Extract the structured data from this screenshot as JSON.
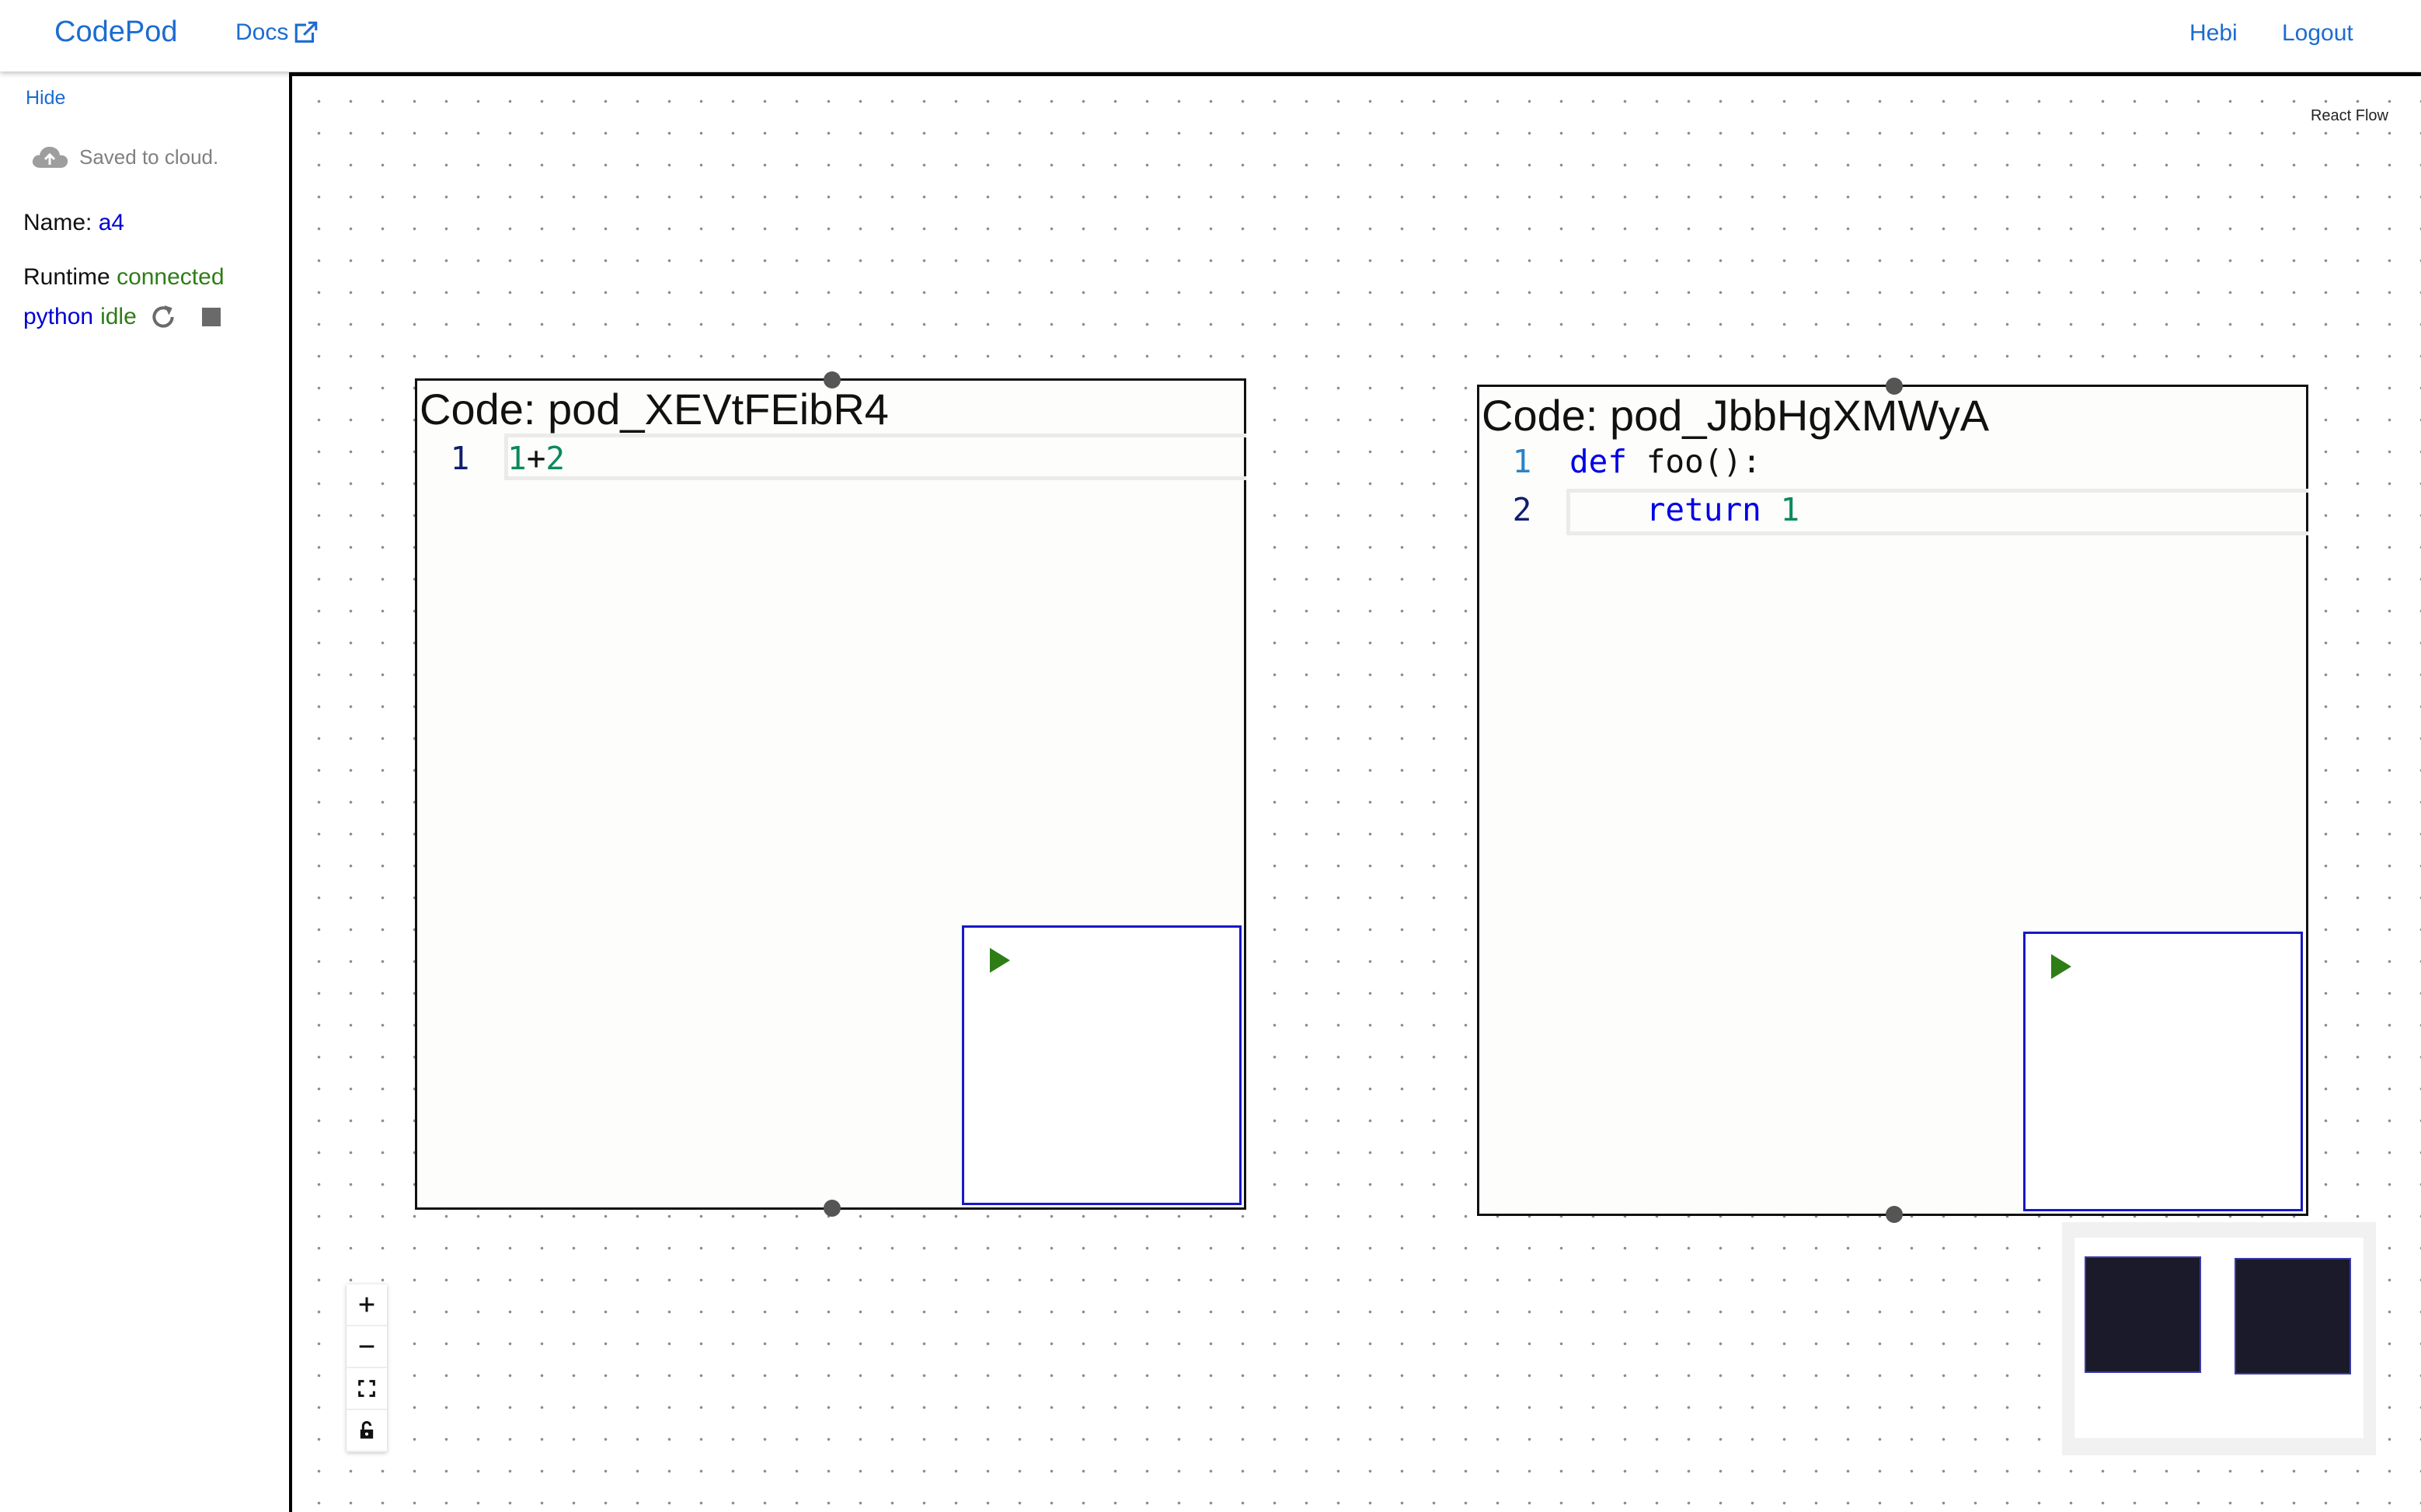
{
  "header": {
    "brand": "CodePod",
    "docs_label": "Docs",
    "docs_icon": "external-link-icon",
    "user_label": "Hebi",
    "logout_label": "Logout"
  },
  "sidebar": {
    "hide_label": "Hide",
    "save_status": "Saved to cloud.",
    "save_icon": "cloud-upload-icon",
    "name_label": "Name:",
    "name_value": "a4",
    "runtime_label": "Runtime",
    "runtime_status": "connected",
    "kernel_name": "python",
    "kernel_status": "idle"
  },
  "canvas": {
    "attribution": "React Flow",
    "pods": [
      {
        "title": "Code: pod_XEVtFEibR4",
        "lines": [
          {
            "number": "1",
            "tokens": [
              "1",
              "+",
              "2"
            ]
          }
        ]
      },
      {
        "title": "Code: pod_JbbHgXMWyA",
        "lines": [
          {
            "number": "1",
            "tokens": [
              "def",
              " foo():"
            ]
          },
          {
            "number": "2",
            "tokens": [
              "    return",
              " 1"
            ]
          }
        ]
      }
    ],
    "controls": [
      "zoom-in-icon",
      "zoom-out-icon",
      "fit-view-icon",
      "lock-icon"
    ]
  },
  "colors": {
    "accent": "#1c6cd0",
    "connected": "#2e7d16",
    "kernel": "#0000d4",
    "result_border": "#1717c8",
    "minimap_node": "#1a1a2a"
  }
}
